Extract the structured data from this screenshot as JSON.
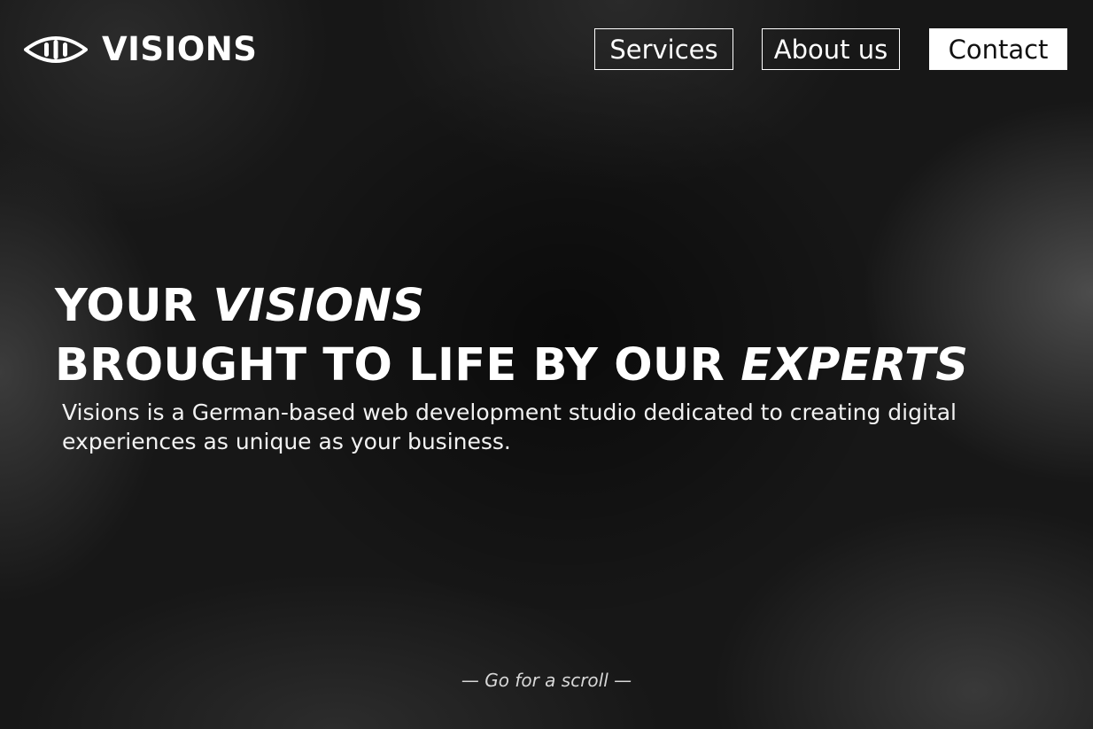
{
  "brand": {
    "name": "VISIONS",
    "icon": "eye-logo-icon"
  },
  "nav": {
    "services": "Services",
    "about": "About us",
    "contact": "Contact"
  },
  "hero": {
    "line1_plain": "YOUR ",
    "line1_emphasis": "VISIONS",
    "line2_plain": "BROUGHT TO LIFE BY OUR ",
    "line2_emphasis": "EXPERTS",
    "description": "Visions is a German-based web development studio dedicated to creating digital experiences as unique as your business."
  },
  "scroll_hint": "— Go for a scroll —",
  "colors": {
    "background": "#171717",
    "text": "#ffffff",
    "contact_button_bg": "#ffffff",
    "contact_button_text": "#111111"
  }
}
